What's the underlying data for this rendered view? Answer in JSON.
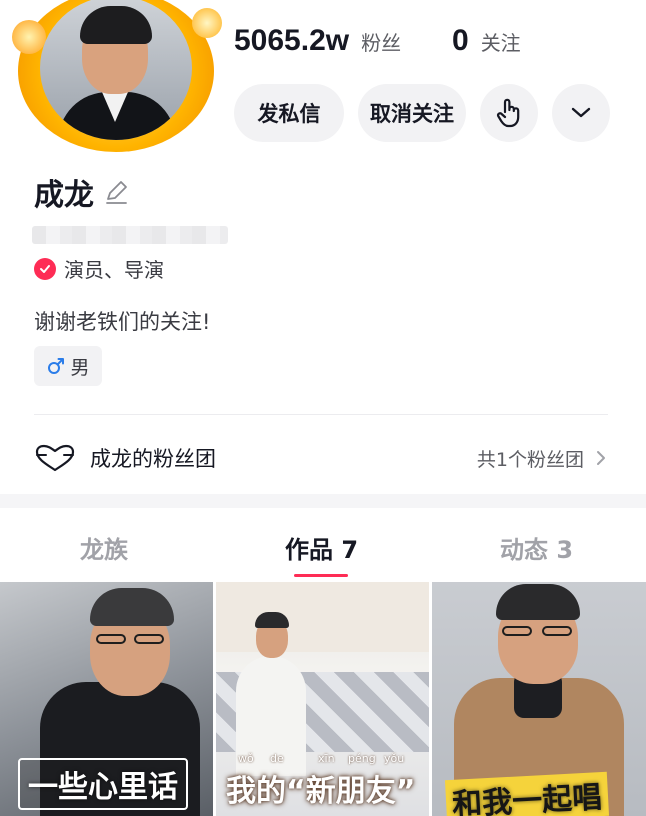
{
  "profile": {
    "name": "成龙",
    "verification": "演员、导演",
    "bio": "谢谢老铁们的关注!",
    "gender": "男"
  },
  "stats": {
    "fans_value": "5065.2w",
    "fans_label": "粉丝",
    "following_value": "0",
    "following_label": "关注"
  },
  "actions": {
    "message_label": "发私信",
    "unfollow_label": "取消关注"
  },
  "fan_club": {
    "name": "成龙的粉丝团",
    "count": "共1个粉丝团"
  },
  "tabs": [
    {
      "label": "龙族"
    },
    {
      "label": "作品 7"
    },
    {
      "label": "动态 3"
    }
  ],
  "videos": [
    {
      "caption": "一些心里话"
    },
    {
      "caption": "我的“新朋友”",
      "pinyin": [
        "wǒ",
        "de",
        "xīn",
        "péng",
        "yǒu"
      ]
    },
    {
      "caption": "和我一起唱"
    }
  ],
  "colors": {
    "accent": "#fe2c55",
    "gender_male": "#2b7de9",
    "button_bg": "#f2f2f4"
  },
  "icons": {
    "edit": "pencil-icon",
    "verified": "check-badge-icon",
    "touch": "hand-pointer-icon",
    "more": "chevron-down-icon",
    "fan_club": "heart-outline-icon",
    "arrow": "chevron-right-icon",
    "gender": "male-icon"
  }
}
